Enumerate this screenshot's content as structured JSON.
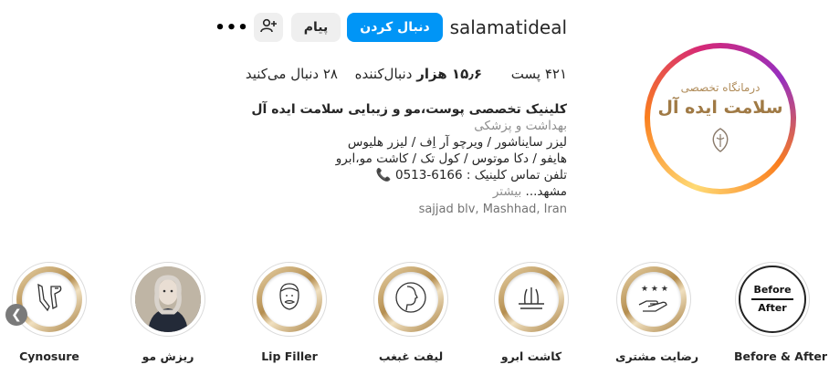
{
  "profile": {
    "username": "salamatideal",
    "follow_label": "دنبال کردن",
    "message_label": "پیام",
    "add_user_icon": "add-user-icon",
    "more_icon": "more-icon",
    "avatar_logo": {
      "subtitle": "درمانگاه تخصصی",
      "title": "سلامت ایده آل"
    }
  },
  "stats": {
    "posts_count": "۴۲۱",
    "posts_label": "پست",
    "followers_count": "۱۵٫۶ هزار",
    "followers_label": "دنبال‌کننده",
    "following_count": "۲۸",
    "following_label": "دنبال می‌کنید"
  },
  "bio": {
    "name": "کلینیک تخصصی پوست،مو و زیبایی سلامت ایده آل",
    "category": "بهداشت و پزشکی",
    "line1": "لیزر سایناشور / ویرچو آر اِف / لیزر هلیوس",
    "line2": "هایفو / دکا موتوس / کول تک / کاشت مو،ابرو",
    "line3": "تلفن تماس کلینیک : 6166-0513",
    "line4": "مشهد...",
    "more": "بیشتر",
    "location": "sajjad blv, Mashhad, Iran"
  },
  "highlights": [
    {
      "label": "Before & After",
      "icon": "before-after-badge"
    },
    {
      "label": "رضایت مشتری",
      "icon": "hand-stars-icon"
    },
    {
      "label": "کاشت ابرو",
      "icon": "eyebrow-implant-icon"
    },
    {
      "label": "لیفت غبغب",
      "icon": "face-profile-icon"
    },
    {
      "label": "Lip Filler",
      "icon": "face-lips-icon"
    },
    {
      "label": "ریزش مو",
      "icon": "woman-photo"
    },
    {
      "label": "Cynosure",
      "icon": "laser-device-icon"
    }
  ],
  "before_after": {
    "top": "Before",
    "bottom": "After"
  },
  "colors": {
    "accent": "#0095f6",
    "gold": "#b58e4f",
    "phone": "#e0343c"
  }
}
